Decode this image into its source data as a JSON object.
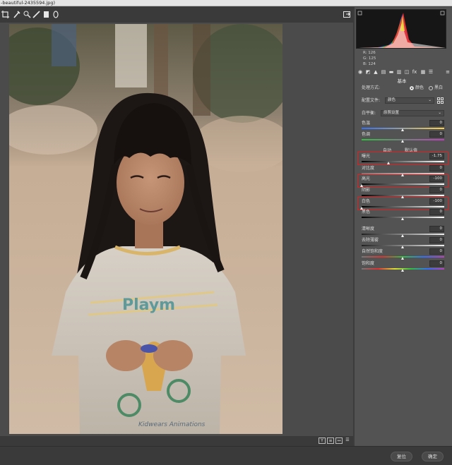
{
  "window": {
    "title": "-beautiful-2435594.jpg)"
  },
  "toolbar": {
    "tools": [
      "crop-tool-icon",
      "eyedropper-icon",
      "target-adjust-icon",
      "brush-icon",
      "filter-icon",
      "ellipse-icon"
    ],
    "fullscreen_icon": "fullscreen-toggle-icon"
  },
  "histogram": {
    "readout": {
      "r_label": "R:",
      "r": "126",
      "g_label": "G:",
      "g": "125",
      "b_label": "B:",
      "b": "124"
    }
  },
  "panel": {
    "title": "基本",
    "treatment": {
      "label": "处理方式:",
      "option_color": "颜色",
      "option_bw": "黑白",
      "selected": "颜色"
    },
    "profile": {
      "label": "配置文件:",
      "value": "颜色"
    },
    "white_balance": {
      "label": "白平衡:",
      "value": "原照设置"
    },
    "temp": {
      "label": "色温",
      "value": "0",
      "level": 0.5
    },
    "tint": {
      "label": "色调",
      "value": "0",
      "level": 0.5
    },
    "auto_label": "自动",
    "default_label": "默认值",
    "exposure": {
      "label": "曝光",
      "value": "-1.75",
      "level": 0.33
    },
    "contrast": {
      "label": "对比度",
      "value": "0",
      "level": 0.5
    },
    "highlights": {
      "label": "高光",
      "value": "-100",
      "level": 0.0
    },
    "shadows": {
      "label": "阴影",
      "value": "0",
      "level": 0.5
    },
    "whites": {
      "label": "白色",
      "value": "-100",
      "level": 0.0
    },
    "blacks": {
      "label": "黑色",
      "value": "0",
      "level": 0.5
    },
    "texture": {
      "label": "清晰度",
      "value": "0",
      "level": 0.5
    },
    "dehaze": {
      "label": "去除薄雾",
      "value": "0",
      "level": 0.5
    },
    "vibrance": {
      "label": "自然饱和度",
      "value": "0",
      "level": 0.5
    },
    "saturation": {
      "label": "饱和度",
      "value": "0",
      "level": 0.5
    }
  },
  "bottombar": {
    "buttons": [
      "Y",
      "≡",
      "↔",
      "☰"
    ]
  },
  "footer": {
    "reset_label": "复位",
    "ok_label": "确定"
  }
}
